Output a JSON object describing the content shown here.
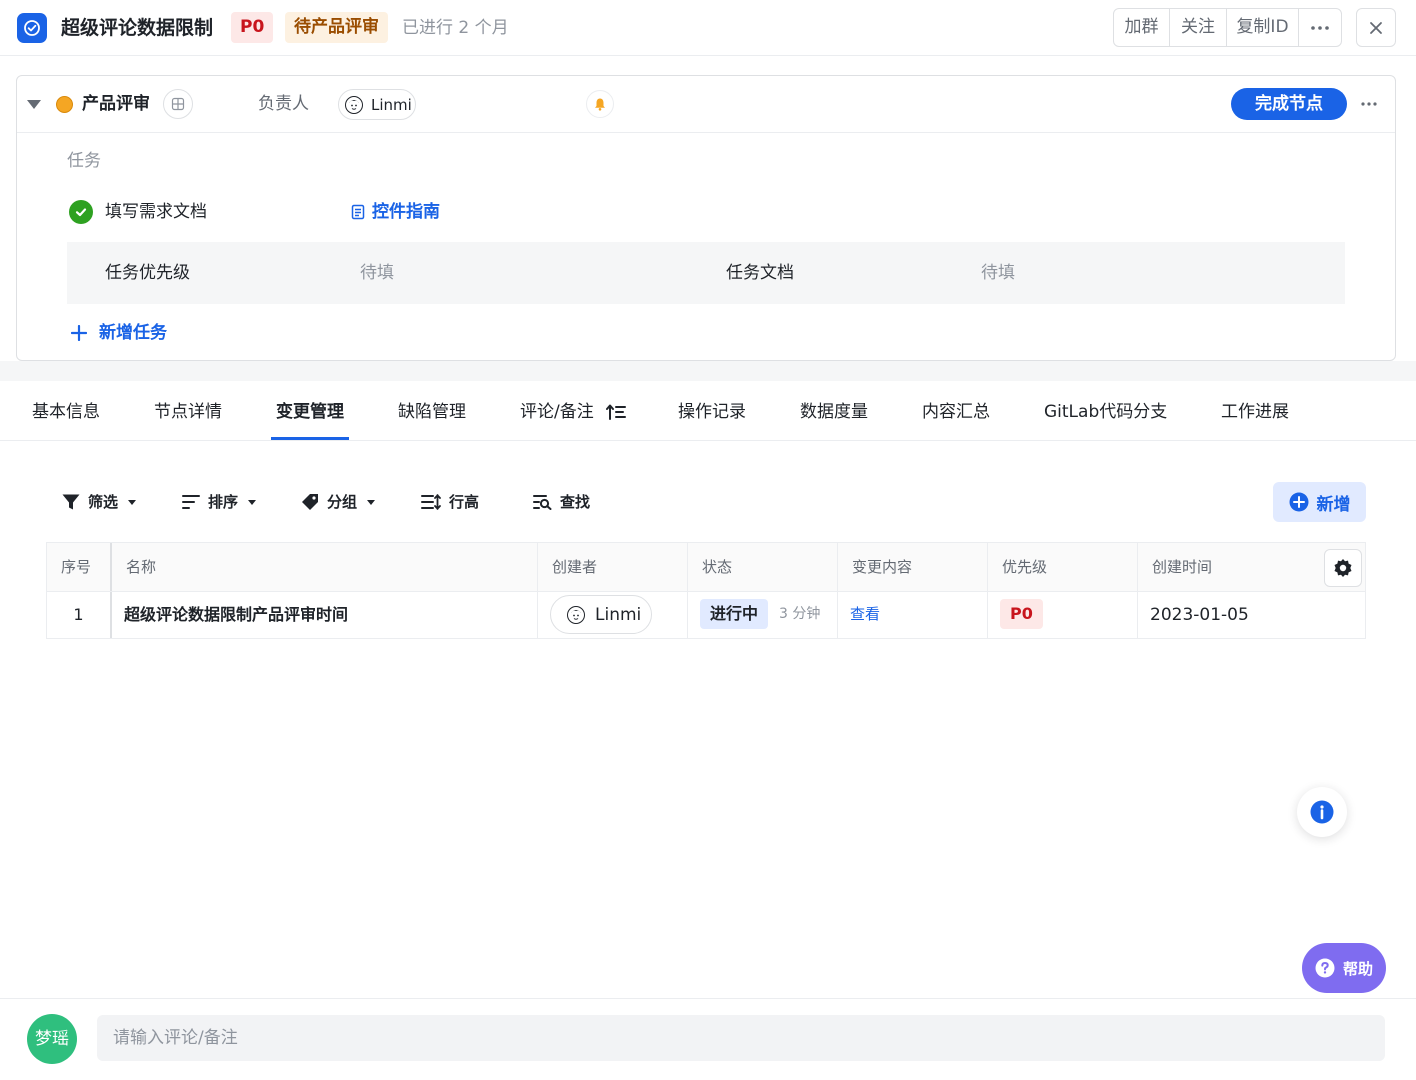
{
  "header": {
    "title": "超级评论数据限制",
    "priority_tag": "P0",
    "status_tag": "待产品评审",
    "elapsed": "已进行 2 个月",
    "actions": [
      "加群",
      "关注",
      "复制ID"
    ]
  },
  "node": {
    "name": "产品评审",
    "owner_label": "负责人",
    "owner_name": "Linmi",
    "complete_label": "完成节点",
    "tasks_label": "任务",
    "task": {
      "name": "填写需求文档",
      "guide_link": "控件指南",
      "fields": [
        {
          "label": "任务优先级",
          "value": "待填"
        },
        {
          "label": "任务文档",
          "value": "待填"
        }
      ]
    },
    "add_task_label": "新增任务"
  },
  "tabs": [
    {
      "label": "基本信息"
    },
    {
      "label": "节点详情"
    },
    {
      "label": "变更管理",
      "active": true
    },
    {
      "label": "缺陷管理"
    },
    {
      "label": "评论/备注"
    },
    {
      "label": "操作记录"
    },
    {
      "label": "数据度量"
    },
    {
      "label": "内容汇总"
    },
    {
      "label": "GitLab代码分支"
    },
    {
      "label": "工作进展"
    }
  ],
  "toolbar": {
    "filter": "筛选",
    "sort": "排序",
    "group": "分组",
    "row_height": "行高",
    "find": "查找",
    "new": "新增"
  },
  "table": {
    "columns": [
      "序号",
      "名称",
      "创建者",
      "状态",
      "变更内容",
      "优先级",
      "创建时间"
    ],
    "rows": [
      {
        "index": "1",
        "name": "超级评论数据限制产品评审时间",
        "creator": "Linmi",
        "status": "进行中",
        "status_time": "3 分钟",
        "change": "查看",
        "priority": "P0",
        "created": "2023-01-05"
      }
    ]
  },
  "help_label": "帮助",
  "comment": {
    "avatar_text": "梦瑶",
    "placeholder": "请输入评论/备注"
  },
  "colors": {
    "accent": "#1a63e6",
    "danger": "#c8151d",
    "success": "#2ea121",
    "warning": "#f5a623",
    "help": "#7f6cf0"
  }
}
